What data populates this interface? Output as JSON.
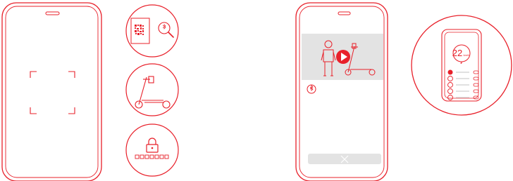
{
  "colors": {
    "accent": "#e8202a",
    "video_bg": "#e3e3e3",
    "grey_button": "#e3e3e3",
    "line_grey": "#cfcfcf"
  },
  "icons": {
    "scan_frame": "qr-scan-frame-icon",
    "qr_search": "qr-code-magnifier-icon",
    "scooter": "electric-scooter-icon",
    "passcode": "padlock-passcode-icon",
    "play": "play-button-icon",
    "bluetooth": "bluetooth-icon",
    "close": "close-x-icon"
  },
  "dashboard": {
    "speed_value": "22",
    "speed_unit": "km/h"
  }
}
